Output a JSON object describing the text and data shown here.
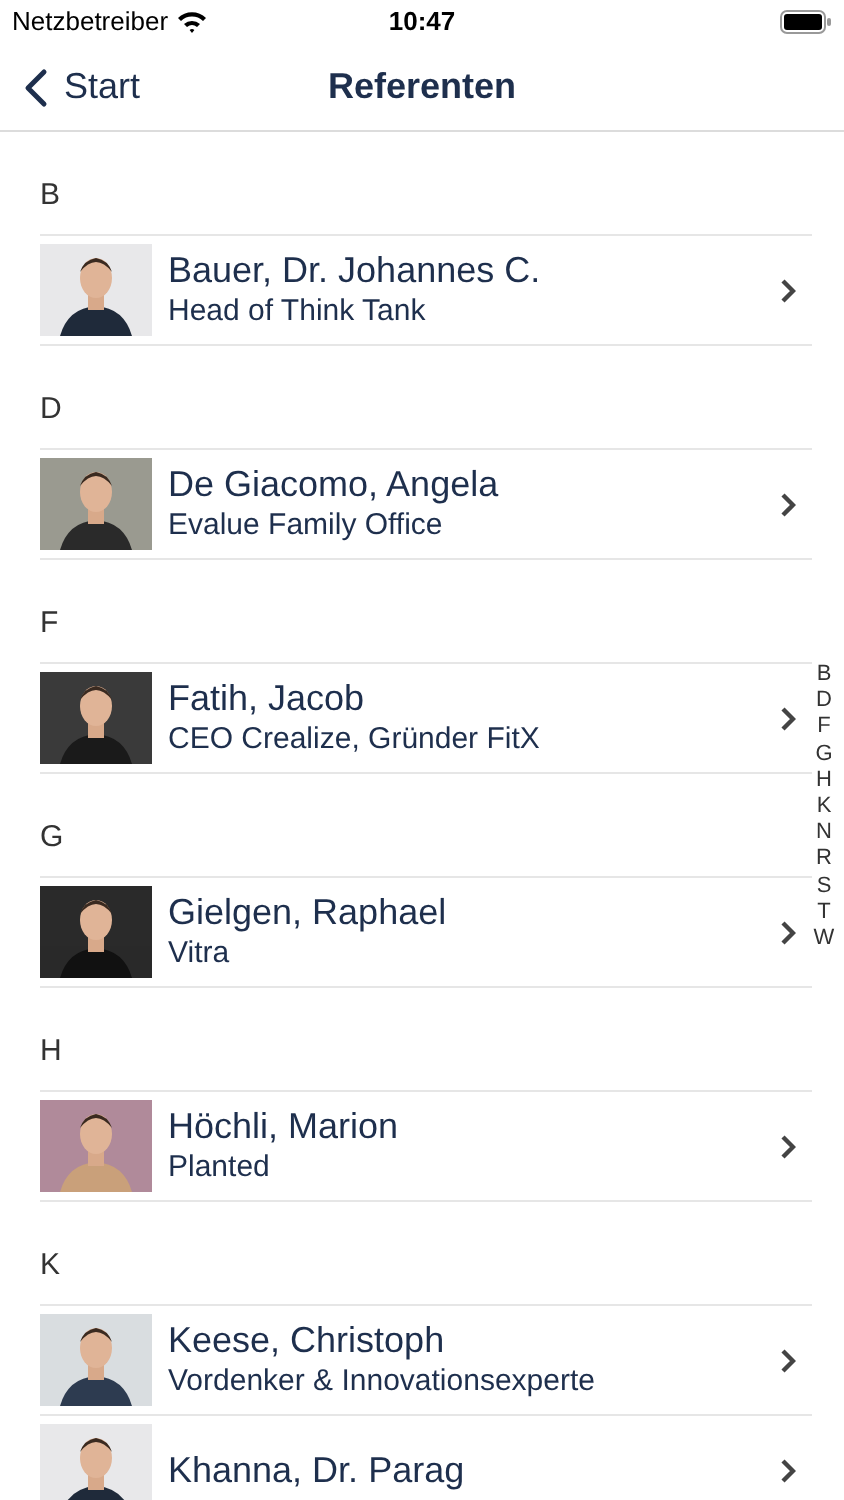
{
  "status_bar": {
    "carrier": "Netzbetreiber",
    "time": "10:47"
  },
  "nav": {
    "back": "Start",
    "title": "Referenten"
  },
  "sections": [
    {
      "letter": "B",
      "people": [
        {
          "name": "Bauer, Dr. Johannes C.",
          "subtitle": "Head of Think Tank"
        }
      ]
    },
    {
      "letter": "D",
      "people": [
        {
          "name": "De Giacomo, Angela",
          "subtitle": "Evalue Family Office"
        }
      ]
    },
    {
      "letter": "F",
      "people": [
        {
          "name": "Fatih, Jacob",
          "subtitle": "CEO Crealize, Gründer FitX"
        }
      ]
    },
    {
      "letter": "G",
      "people": [
        {
          "name": "Gielgen, Raphael",
          "subtitle": "Vitra"
        }
      ]
    },
    {
      "letter": "H",
      "people": [
        {
          "name": "Höchli, Marion",
          "subtitle": "Planted"
        }
      ]
    },
    {
      "letter": "K",
      "people": [
        {
          "name": "Keese, Christoph",
          "subtitle": "Vordenker & Innovationsexperte"
        },
        {
          "name": "Khanna, Dr. Parag"
        }
      ]
    }
  ],
  "index": [
    "B",
    "D",
    "F",
    "G",
    "H",
    "K",
    "N",
    "R",
    "S",
    "T",
    "W"
  ]
}
